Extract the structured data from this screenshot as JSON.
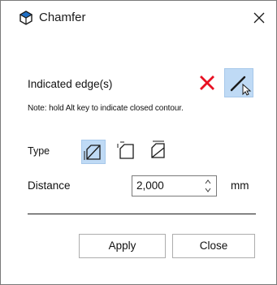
{
  "window": {
    "title": "Chamfer",
    "app_icon": "cube-icon",
    "close_icon": "close-icon"
  },
  "edge_selection": {
    "label": "Indicated edge(s)",
    "clear_icon": "red-x-icon",
    "select_icon": "edge-select-icon",
    "note": "Note: hold Alt key to indicate closed contour."
  },
  "type": {
    "label": "Type",
    "options": [
      "chamfer-type-1-icon",
      "chamfer-type-2-icon",
      "chamfer-type-3-icon"
    ],
    "selected_index": 0
  },
  "distance": {
    "label": "Distance",
    "value": "2,000",
    "unit": "mm"
  },
  "buttons": {
    "apply": "Apply",
    "close": "Close"
  },
  "colors": {
    "selected_bg": "#bfdaf5",
    "clear_red": "#e81123",
    "accent_blue": "#1f6fc5"
  }
}
